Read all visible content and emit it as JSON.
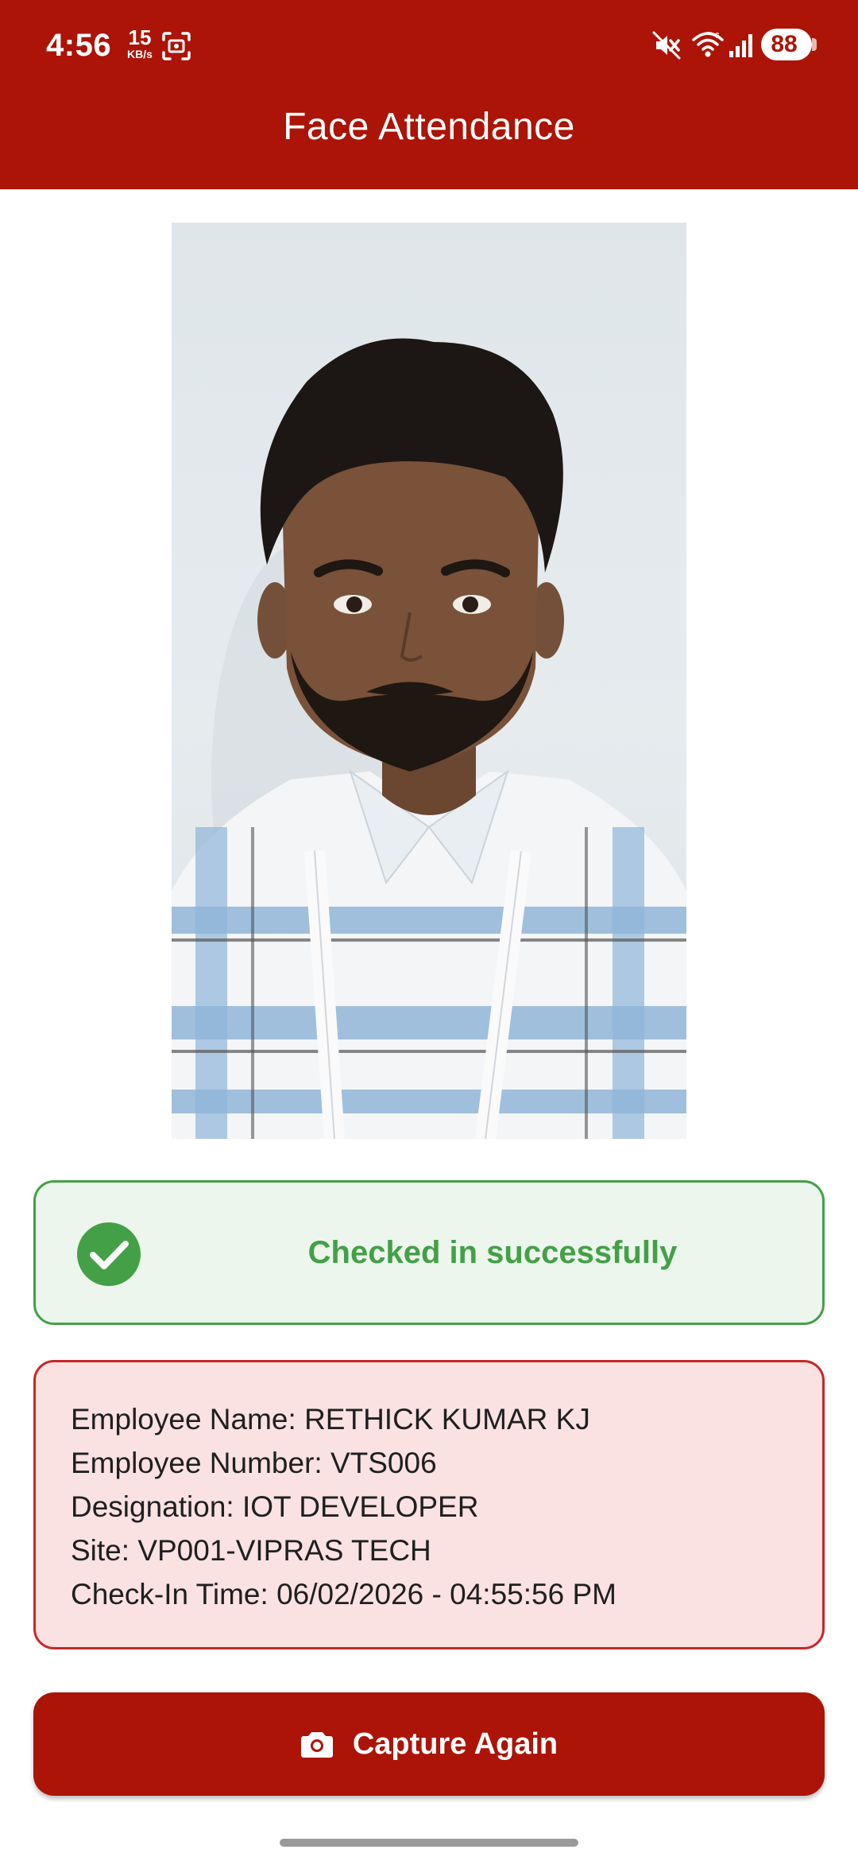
{
  "status_bar": {
    "time": "4:56",
    "net_speed_value": "15",
    "net_speed_unit": "KB/s",
    "battery": "88",
    "icons": [
      "screenshot-icon",
      "mute-icon",
      "wifi-icon",
      "signal-icon",
      "battery-icon"
    ]
  },
  "header": {
    "title": "Face Attendance"
  },
  "status_message": {
    "text": "Checked in successfully",
    "icon": "check-circle-icon"
  },
  "employee": {
    "name_line": "Employee Name: RETHICK KUMAR KJ",
    "number_line": "Employee Number: VTS006",
    "designation_line": "Designation: IOT DEVELOPER",
    "site_line": "Site: VP001-VIPRAS TECH",
    "checkin_line": "Check-In Time: 06/02/2026 - 04:55:56 PM"
  },
  "actions": {
    "capture_label": "Capture Again",
    "capture_icon": "camera-icon"
  },
  "colors": {
    "primary": "#AB1406",
    "success": "#43A047",
    "success_bg": "#EDF6EC",
    "details_border": "#C62828",
    "details_bg": "#FAE1E2"
  }
}
